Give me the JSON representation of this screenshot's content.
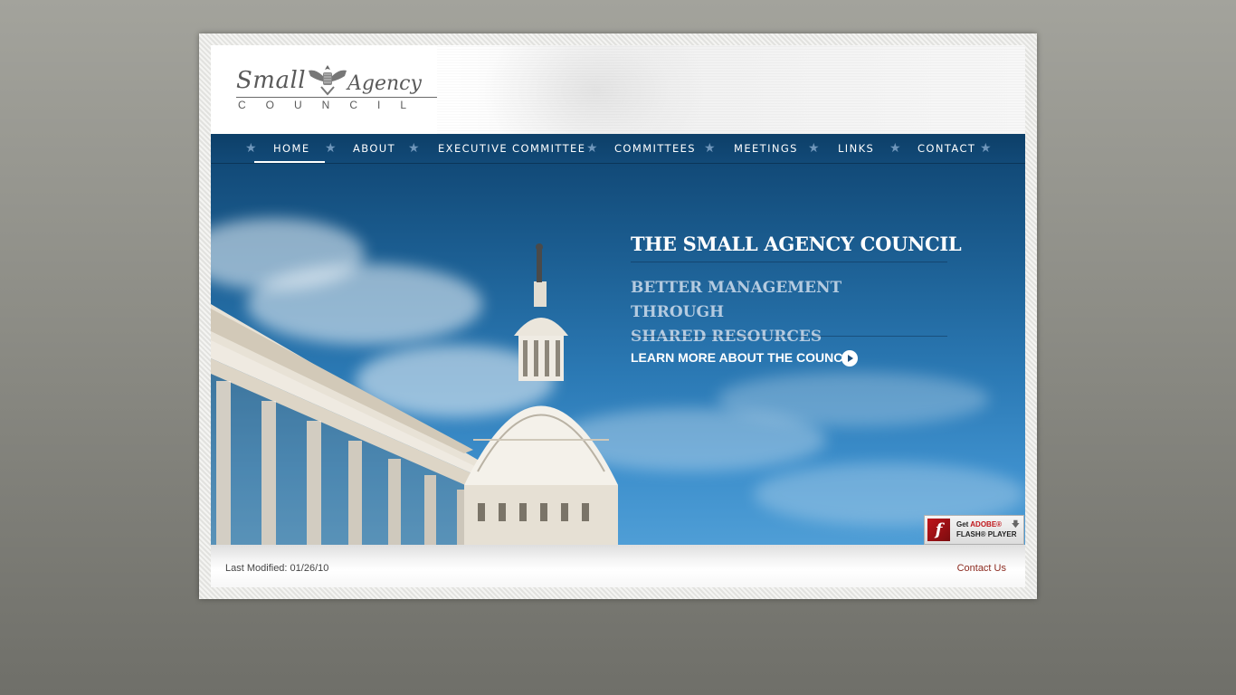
{
  "logo": {
    "word1": "Small",
    "word2": "Agency",
    "word3": "COUNCIL"
  },
  "nav": {
    "items": [
      {
        "label": "HOME",
        "active": true
      },
      {
        "label": "ABOUT"
      },
      {
        "label": "EXECUTIVE COMMITTEE"
      },
      {
        "label": "COMMITTEES"
      },
      {
        "label": "MEETINGS"
      },
      {
        "label": "LINKS"
      },
      {
        "label": "CONTACT"
      }
    ],
    "separator": "★"
  },
  "hero": {
    "title": "THE SMALL AGENCY COUNCIL",
    "subtitle_line1": "BETTER MANAGEMENT THROUGH",
    "subtitle_line2": "SHARED RESOURCES",
    "cta": "LEARN MORE ABOUT THE COUNCIL"
  },
  "flash_badge": {
    "get": "Get",
    "adobe": "ADOBE®",
    "player": "FLASH® PLAYER",
    "icon": "flash-icon"
  },
  "footer": {
    "last_modified": "Last Modified: 01/26/10",
    "contact": "Contact Us"
  },
  "colors": {
    "nav_bg": "#0d3f68",
    "hero_top": "#124a78",
    "hero_bottom": "#4f9ed6",
    "contact_link": "#8b2a1f"
  }
}
